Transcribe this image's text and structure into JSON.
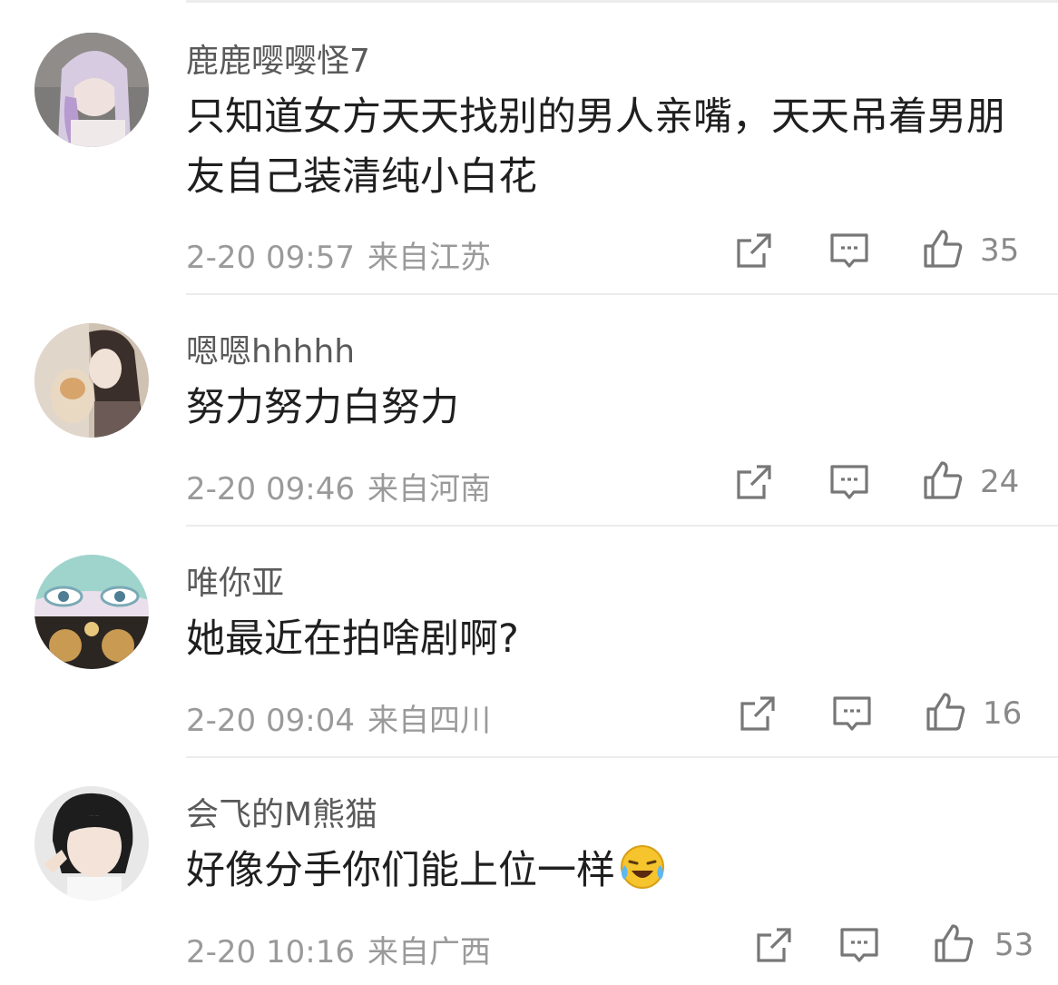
{
  "comments": [
    {
      "username": "鹿鹿嘤嘤怪7",
      "text": "只知道女方天天找别的男人亲嘴，天天吊着男朋友自己装清纯小白花",
      "time": "2-20 09:57",
      "location": "来自江苏",
      "likes": "35",
      "avatar_colors": [
        "#c9c6c8",
        "#b39bc6",
        "#e9e0e4"
      ]
    },
    {
      "username": "嗯嗯hhhhh",
      "text": "努力努力白努力",
      "time": "2-20 09:46",
      "location": "来自河南",
      "likes": "24",
      "avatar_colors": [
        "#d9c7b3",
        "#4a3a33",
        "#e8ddd2"
      ]
    },
    {
      "username": "唯你亚",
      "text": "她最近在拍啥剧啊?",
      "time": "2-20 09:04",
      "location": "来自四川",
      "likes": "16",
      "avatar_colors": [
        "#a8d8d0",
        "#c9a36a",
        "#e6d2e8"
      ]
    },
    {
      "username": "会飞的M熊猫",
      "text": "好像分手你们能上位一样",
      "time": "2-20 10:16",
      "location": "来自广西",
      "likes": "53",
      "avatar_colors": [
        "#e6e6e6",
        "#222222",
        "#f3e3d8"
      ],
      "emoji": "laughing-crying-emoji"
    }
  ],
  "icons": {
    "share": "share-icon",
    "comment": "comment-icon",
    "like": "thumbs-up-icon"
  },
  "colors": {
    "text": "#1f1f1f",
    "username": "#5a5a5a",
    "meta": "#9a9a9a",
    "divider": "#ececec"
  }
}
